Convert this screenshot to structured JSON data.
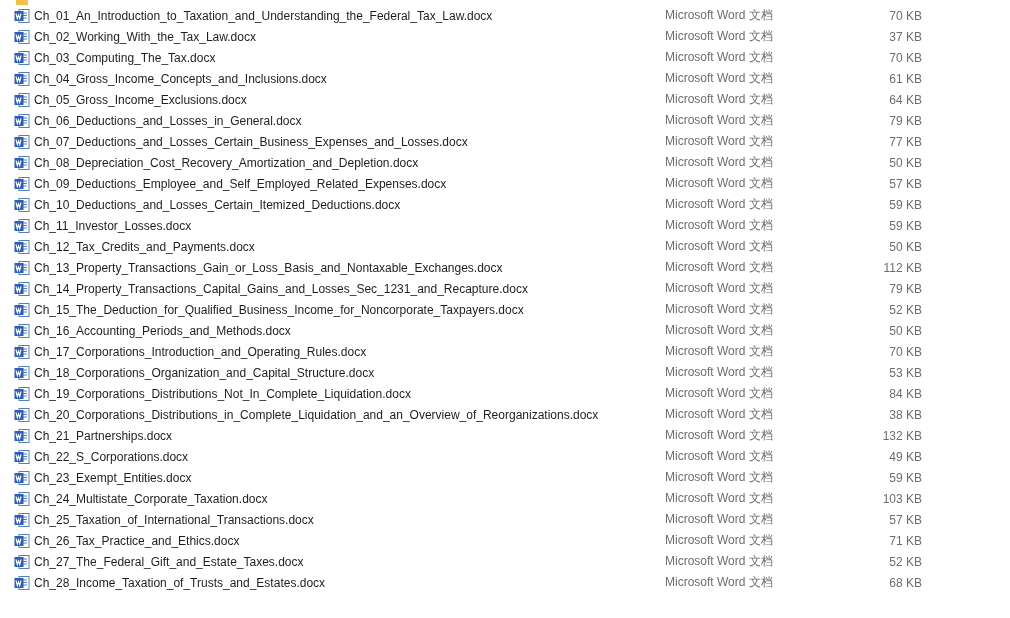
{
  "files": [
    {
      "name": "Ch_01_An_Introduction_to_Taxation_and_Understanding_the_Federal_Tax_Law.docx",
      "type": "Microsoft Word 文档",
      "size": "70 KB"
    },
    {
      "name": "Ch_02_Working_With_the_Tax_Law.docx",
      "type": "Microsoft Word 文档",
      "size": "37 KB"
    },
    {
      "name": "Ch_03_Computing_The_Tax.docx",
      "type": "Microsoft Word 文档",
      "size": "70 KB"
    },
    {
      "name": "Ch_04_Gross_Income_Concepts_and_Inclusions.docx",
      "type": "Microsoft Word 文档",
      "size": "61 KB"
    },
    {
      "name": "Ch_05_Gross_Income_Exclusions.docx",
      "type": "Microsoft Word 文档",
      "size": "64 KB"
    },
    {
      "name": "Ch_06_Deductions_and_Losses_in_General.docx",
      "type": "Microsoft Word 文档",
      "size": "79 KB"
    },
    {
      "name": "Ch_07_Deductions_and_Losses_Certain_Business_Expenses_and_Losses.docx",
      "type": "Microsoft Word 文档",
      "size": "77 KB"
    },
    {
      "name": "Ch_08_Depreciation_Cost_Recovery_Amortization_and_Depletion.docx",
      "type": "Microsoft Word 文档",
      "size": "50 KB"
    },
    {
      "name": "Ch_09_Deductions_Employee_and_Self_Employed_Related_Expenses.docx",
      "type": "Microsoft Word 文档",
      "size": "57 KB"
    },
    {
      "name": "Ch_10_Deductions_and_Losses_Certain_Itemized_Deductions.docx",
      "type": "Microsoft Word 文档",
      "size": "59 KB"
    },
    {
      "name": "Ch_11_Investor_Losses.docx",
      "type": "Microsoft Word 文档",
      "size": "59 KB"
    },
    {
      "name": "Ch_12_Tax_Credits_and_Payments.docx",
      "type": "Microsoft Word 文档",
      "size": "50 KB"
    },
    {
      "name": "Ch_13_Property_Transactions_Gain_or_Loss_Basis_and_Nontaxable_Exchanges.docx",
      "type": "Microsoft Word 文档",
      "size": "112 KB"
    },
    {
      "name": "Ch_14_Property_Transactions_Capital_Gains_and_Losses_Sec_1231_and_Recapture.docx",
      "type": "Microsoft Word 文档",
      "size": "79 KB"
    },
    {
      "name": "Ch_15_The_Deduction_for_Qualified_Business_Income_for_Noncorporate_Taxpayers.docx",
      "type": "Microsoft Word 文档",
      "size": "52 KB"
    },
    {
      "name": "Ch_16_Accounting_Periods_and_Methods.docx",
      "type": "Microsoft Word 文档",
      "size": "50 KB"
    },
    {
      "name": "Ch_17_Corporations_Introduction_and_Operating_Rules.docx",
      "type": "Microsoft Word 文档",
      "size": "70 KB"
    },
    {
      "name": "Ch_18_Corporations_Organization_and_Capital_Structure.docx",
      "type": "Microsoft Word 文档",
      "size": "53 KB"
    },
    {
      "name": "Ch_19_Corporations_Distributions_Not_In_Complete_Liquidation.docx",
      "type": "Microsoft Word 文档",
      "size": "84 KB"
    },
    {
      "name": "Ch_20_Corporations_Distributions_in_Complete_Liquidation_and_an_Overview_of_Reorganizations.docx",
      "type": "Microsoft Word 文档",
      "size": "38 KB"
    },
    {
      "name": "Ch_21_Partnerships.docx",
      "type": "Microsoft Word 文档",
      "size": "132 KB"
    },
    {
      "name": "Ch_22_S_Corporations.docx",
      "type": "Microsoft Word 文档",
      "size": "49 KB"
    },
    {
      "name": "Ch_23_Exempt_Entities.docx",
      "type": "Microsoft Word 文档",
      "size": "59 KB"
    },
    {
      "name": "Ch_24_Multistate_Corporate_Taxation.docx",
      "type": "Microsoft Word 文档",
      "size": "103 KB"
    },
    {
      "name": "Ch_25_Taxation_of_International_Transactions.docx",
      "type": "Microsoft Word 文档",
      "size": "57 KB"
    },
    {
      "name": "Ch_26_Tax_Practice_and_Ethics.docx",
      "type": "Microsoft Word 文档",
      "size": "71 KB"
    },
    {
      "name": "Ch_27_The_Federal_Gift_and_Estate_Taxes.docx",
      "type": "Microsoft Word 文档",
      "size": "52 KB"
    },
    {
      "name": "Ch_28_Income_Taxation_of_Trusts_and_Estates.docx",
      "type": "Microsoft Word 文档",
      "size": "68 KB"
    }
  ]
}
